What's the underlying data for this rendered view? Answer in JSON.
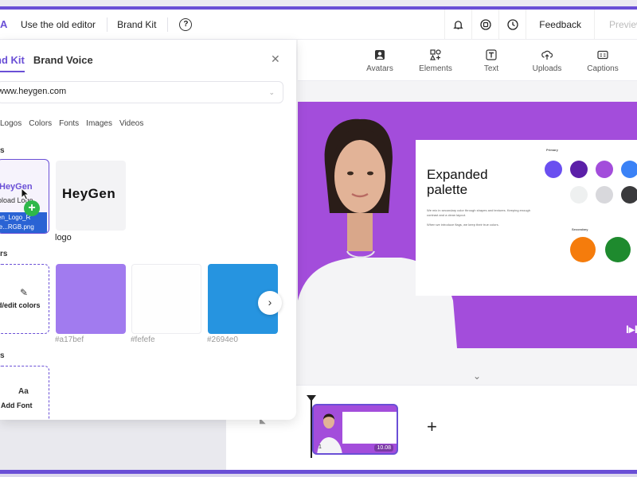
{
  "header": {
    "app_letter": "A",
    "old_editor": "Use the old editor",
    "brand_kit": "Brand Kit",
    "help": "?",
    "feedback": "Feedback",
    "preview": "Preview"
  },
  "toolbar": {
    "items": [
      {
        "label": "Avatars",
        "icon": "avatar-icon"
      },
      {
        "label": "Elements",
        "icon": "elements-icon"
      },
      {
        "label": "Text",
        "icon": "text-icon"
      },
      {
        "label": "Uploads",
        "icon": "upload-icon"
      },
      {
        "label": "Captions",
        "icon": "captions-icon"
      }
    ]
  },
  "panel": {
    "tabs": [
      "nd Kit",
      "Brand Voice"
    ],
    "url": "www.heygen.com",
    "filters": [
      "Logos",
      "Colors",
      "Fonts",
      "Images",
      "Videos"
    ],
    "sections": {
      "logos": "s",
      "colors": "rs",
      "fonts": "s"
    },
    "upload": {
      "ghost": "HeyGen",
      "label": "pload Logo",
      "file_line1": "en_Logo_R",
      "file_line2": "le...RGB.png"
    },
    "logo_card": {
      "wordmark": "HeyGen",
      "caption": "logo"
    },
    "add_colors_label": "d/edit colors",
    "swatches": [
      {
        "hex": "#a17bef",
        "label": "#a17bef"
      },
      {
        "hex": "#fefefe",
        "label": "#fefefe"
      },
      {
        "hex": "#2694e0",
        "label": "#2694e0"
      }
    ],
    "add_font_label": "Add Font"
  },
  "slide": {
    "title": "Expanded palette",
    "text1": "We mix in secondary color through shapes and textures. Keeping enough contrast and a clean layout.",
    "text2": "When we introduce flags, we keep their true colors.",
    "primary_label": "Primary",
    "secondary_label": "Secondary",
    "primary_colors": [
      "#6a4ff0",
      "#5b1fa8",
      "#a34ddb",
      "#3b82f6",
      "#eef0f0",
      "#d8d8dc",
      "#3a3a3c"
    ],
    "secondary_colors": [
      "#f57c0c",
      "#1e8a2e"
    ],
    "brand_mark": "I▸I",
    "background": "#a34ddb"
  },
  "timeline": {
    "scene_number": "1",
    "duration": "10.08",
    "add_scene": "+"
  }
}
